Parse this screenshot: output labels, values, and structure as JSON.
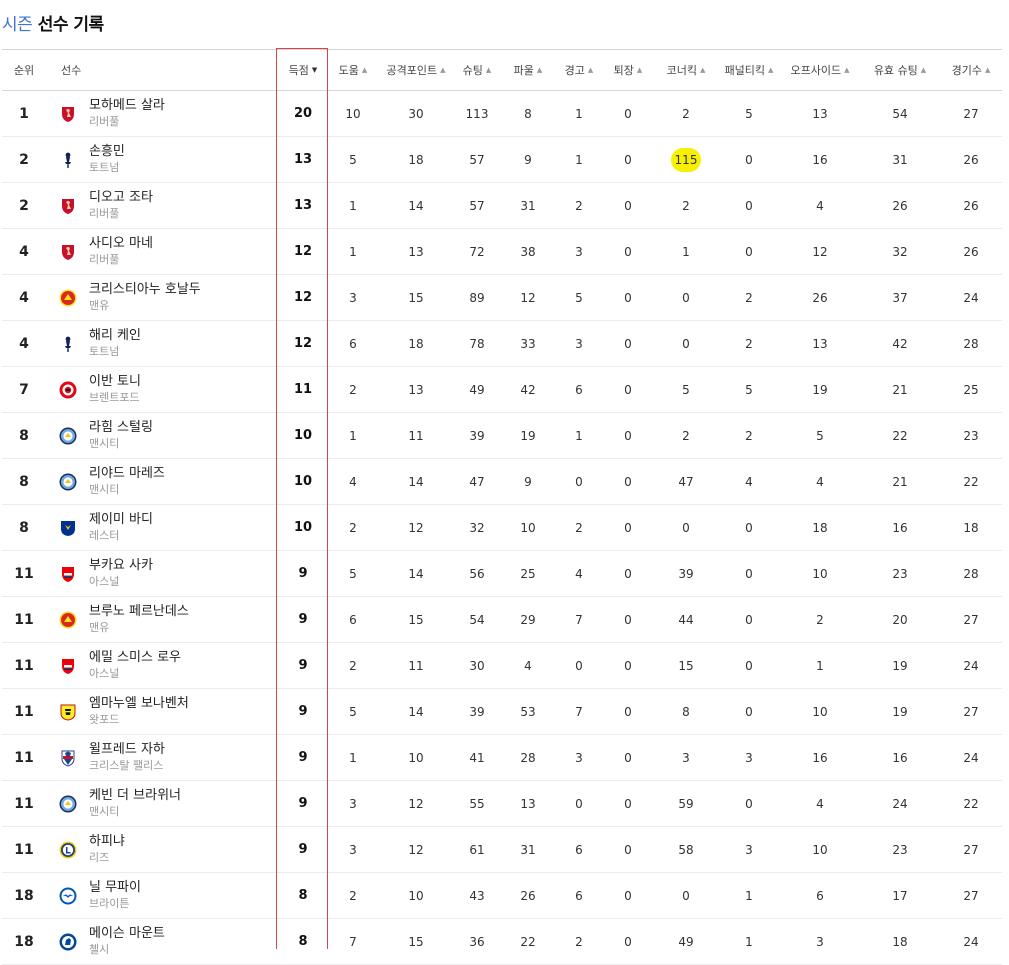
{
  "page": {
    "title_accent": "시즌",
    "title_rest": "선수 기록"
  },
  "columns": {
    "rank": "순위",
    "player": "선수",
    "goals": "득점",
    "assists": "도움",
    "points": "공격포인트",
    "shots": "슈팅",
    "fouls": "파울",
    "yellow": "경고",
    "red": "퇴장",
    "corners": "코너킥",
    "penalties": "패널티킥",
    "offsides": "오프사이드",
    "shots_on": "유효 슈팅",
    "games": "경기수"
  },
  "sort_icons": {
    "active": "▼",
    "inactive": "▲"
  },
  "crests": {
    "liverpool": {
      "icon": "liverbird-icon",
      "color": "#c8102e"
    },
    "tottenham": {
      "icon": "cockerel-icon",
      "color": "#132257"
    },
    "manutd": {
      "icon": "devil-icon",
      "color": "#da291c"
    },
    "brentford": {
      "icon": "bee-icon",
      "color": "#e30613"
    },
    "mancity": {
      "icon": "eagle-icon",
      "color": "#6cabdd"
    },
    "leicester": {
      "icon": "fox-icon",
      "color": "#003090"
    },
    "arsenal": {
      "icon": "cannon-icon",
      "color": "#ef0107"
    },
    "watford": {
      "icon": "hornet-icon",
      "color": "#fbee23"
    },
    "palace": {
      "icon": "palace-eagle-icon",
      "color": "#1b458f"
    },
    "leeds": {
      "icon": "leeds-icon",
      "color": "#1d428a"
    },
    "brighton": {
      "icon": "seagull-icon",
      "color": "#0057b8"
    },
    "chelsea": {
      "icon": "lion-icon",
      "color": "#034694"
    }
  },
  "highlight_color": "#f7f100",
  "rows": [
    {
      "rank": "1",
      "name": "모하메드 살라",
      "team": "리버풀",
      "crest": "liverpool",
      "goals": "20",
      "assists": "10",
      "points": "30",
      "shots": "113",
      "fouls": "8",
      "yellow": "1",
      "red": "0",
      "corners": "2",
      "penalties": "5",
      "offsides": "13",
      "shots_on": "54",
      "games": "27"
    },
    {
      "rank": "2",
      "name": "손흥민",
      "team": "토트넘",
      "crest": "tottenham",
      "goals": "13",
      "assists": "5",
      "points": "18",
      "shots": "57",
      "fouls": "9",
      "yellow": "1",
      "red": "0",
      "corners": "115",
      "penalties": "0",
      "offsides": "16",
      "shots_on": "31",
      "games": "26",
      "highlight": "corners"
    },
    {
      "rank": "2",
      "name": "디오고 조타",
      "team": "리버풀",
      "crest": "liverpool",
      "goals": "13",
      "assists": "1",
      "points": "14",
      "shots": "57",
      "fouls": "31",
      "yellow": "2",
      "red": "0",
      "corners": "2",
      "penalties": "0",
      "offsides": "4",
      "shots_on": "26",
      "games": "26"
    },
    {
      "rank": "4",
      "name": "사디오 마네",
      "team": "리버풀",
      "crest": "liverpool",
      "goals": "12",
      "assists": "1",
      "points": "13",
      "shots": "72",
      "fouls": "38",
      "yellow": "3",
      "red": "0",
      "corners": "1",
      "penalties": "0",
      "offsides": "12",
      "shots_on": "32",
      "games": "26"
    },
    {
      "rank": "4",
      "name": "크리스티아누 호날두",
      "team": "맨유",
      "crest": "manutd",
      "goals": "12",
      "assists": "3",
      "points": "15",
      "shots": "89",
      "fouls": "12",
      "yellow": "5",
      "red": "0",
      "corners": "0",
      "penalties": "2",
      "offsides": "26",
      "shots_on": "37",
      "games": "24"
    },
    {
      "rank": "4",
      "name": "해리 케인",
      "team": "토트넘",
      "crest": "tottenham",
      "goals": "12",
      "assists": "6",
      "points": "18",
      "shots": "78",
      "fouls": "33",
      "yellow": "3",
      "red": "0",
      "corners": "0",
      "penalties": "2",
      "offsides": "13",
      "shots_on": "42",
      "games": "28"
    },
    {
      "rank": "7",
      "name": "이반 토니",
      "team": "브렌트포드",
      "crest": "brentford",
      "goals": "11",
      "assists": "2",
      "points": "13",
      "shots": "49",
      "fouls": "42",
      "yellow": "6",
      "red": "0",
      "corners": "5",
      "penalties": "5",
      "offsides": "19",
      "shots_on": "21",
      "games": "25"
    },
    {
      "rank": "8",
      "name": "라힘 스털링",
      "team": "맨시티",
      "crest": "mancity",
      "goals": "10",
      "assists": "1",
      "points": "11",
      "shots": "39",
      "fouls": "19",
      "yellow": "1",
      "red": "0",
      "corners": "2",
      "penalties": "2",
      "offsides": "5",
      "shots_on": "22",
      "games": "23"
    },
    {
      "rank": "8",
      "name": "리야드 마레즈",
      "team": "맨시티",
      "crest": "mancity",
      "goals": "10",
      "assists": "4",
      "points": "14",
      "shots": "47",
      "fouls": "9",
      "yellow": "0",
      "red": "0",
      "corners": "47",
      "penalties": "4",
      "offsides": "4",
      "shots_on": "21",
      "games": "22"
    },
    {
      "rank": "8",
      "name": "제이미 바디",
      "team": "레스터",
      "crest": "leicester",
      "goals": "10",
      "assists": "2",
      "points": "12",
      "shots": "32",
      "fouls": "10",
      "yellow": "2",
      "red": "0",
      "corners": "0",
      "penalties": "0",
      "offsides": "18",
      "shots_on": "16",
      "games": "18"
    },
    {
      "rank": "11",
      "name": "부카요 사카",
      "team": "아스널",
      "crest": "arsenal",
      "goals": "9",
      "assists": "5",
      "points": "14",
      "shots": "56",
      "fouls": "25",
      "yellow": "4",
      "red": "0",
      "corners": "39",
      "penalties": "0",
      "offsides": "10",
      "shots_on": "23",
      "games": "28"
    },
    {
      "rank": "11",
      "name": "브루노 페르난데스",
      "team": "맨유",
      "crest": "manutd",
      "goals": "9",
      "assists": "6",
      "points": "15",
      "shots": "54",
      "fouls": "29",
      "yellow": "7",
      "red": "0",
      "corners": "44",
      "penalties": "0",
      "offsides": "2",
      "shots_on": "20",
      "games": "27"
    },
    {
      "rank": "11",
      "name": "에밀 스미스 로우",
      "team": "아스널",
      "crest": "arsenal",
      "goals": "9",
      "assists": "2",
      "points": "11",
      "shots": "30",
      "fouls": "4",
      "yellow": "0",
      "red": "0",
      "corners": "15",
      "penalties": "0",
      "offsides": "1",
      "shots_on": "19",
      "games": "24"
    },
    {
      "rank": "11",
      "name": "엠마누엘 보나벤처",
      "team": "왓포드",
      "crest": "watford",
      "goals": "9",
      "assists": "5",
      "points": "14",
      "shots": "39",
      "fouls": "53",
      "yellow": "7",
      "red": "0",
      "corners": "8",
      "penalties": "0",
      "offsides": "10",
      "shots_on": "19",
      "games": "27"
    },
    {
      "rank": "11",
      "name": "윌프레드 자하",
      "team": "크리스탈 팰리스",
      "crest": "palace",
      "goals": "9",
      "assists": "1",
      "points": "10",
      "shots": "41",
      "fouls": "28",
      "yellow": "3",
      "red": "0",
      "corners": "3",
      "penalties": "3",
      "offsides": "16",
      "shots_on": "16",
      "games": "24"
    },
    {
      "rank": "11",
      "name": "케빈 더 브라위너",
      "team": "맨시티",
      "crest": "mancity",
      "goals": "9",
      "assists": "3",
      "points": "12",
      "shots": "55",
      "fouls": "13",
      "yellow": "0",
      "red": "0",
      "corners": "59",
      "penalties": "0",
      "offsides": "4",
      "shots_on": "24",
      "games": "22"
    },
    {
      "rank": "11",
      "name": "하피냐",
      "team": "리즈",
      "crest": "leeds",
      "goals": "9",
      "assists": "3",
      "points": "12",
      "shots": "61",
      "fouls": "31",
      "yellow": "6",
      "red": "0",
      "corners": "58",
      "penalties": "3",
      "offsides": "10",
      "shots_on": "23",
      "games": "27"
    },
    {
      "rank": "18",
      "name": "닐 무파이",
      "team": "브라이튼",
      "crest": "brighton",
      "goals": "8",
      "assists": "2",
      "points": "10",
      "shots": "43",
      "fouls": "26",
      "yellow": "6",
      "red": "0",
      "corners": "0",
      "penalties": "1",
      "offsides": "6",
      "shots_on": "17",
      "games": "27"
    },
    {
      "rank": "18",
      "name": "메이슨 마운트",
      "team": "첼시",
      "crest": "chelsea",
      "goals": "8",
      "assists": "7",
      "points": "15",
      "shots": "36",
      "fouls": "22",
      "yellow": "2",
      "red": "0",
      "corners": "49",
      "penalties": "1",
      "offsides": "3",
      "shots_on": "18",
      "games": "24"
    }
  ]
}
